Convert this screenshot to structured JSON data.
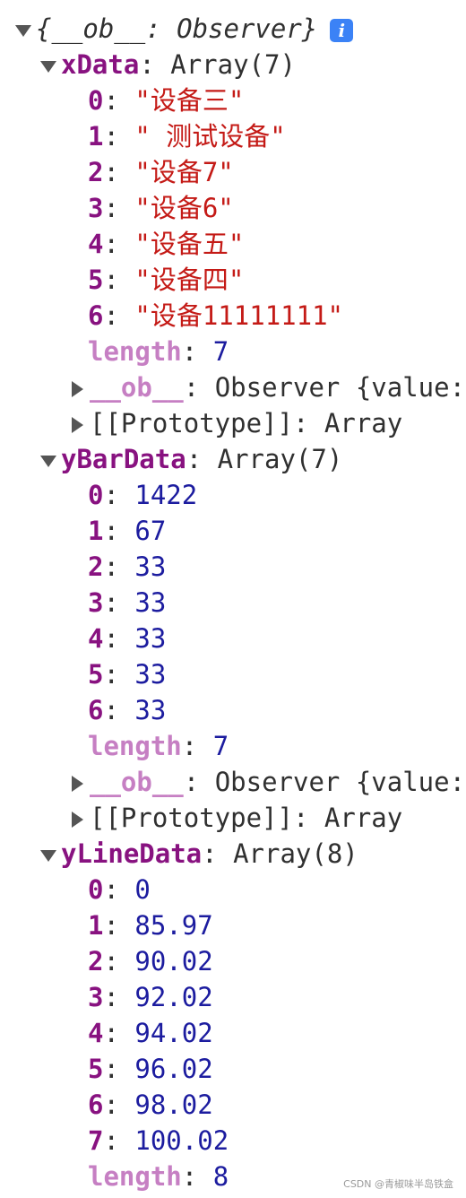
{
  "root": {
    "label": "{__ob__: Observer}",
    "info_icon": "i"
  },
  "xData": {
    "key": "xData",
    "summary": "Array(7)",
    "items": [
      {
        "index": "0",
        "value": "\"设备三\""
      },
      {
        "index": "1",
        "value": "\"  测试设备\""
      },
      {
        "index": "2",
        "value": "\"设备7\""
      },
      {
        "index": "3",
        "value": "\"设备6\""
      },
      {
        "index": "4",
        "value": "\"设备五\""
      },
      {
        "index": "5",
        "value": "\"设备四\""
      },
      {
        "index": "6",
        "value": "\"设备11111111\""
      }
    ],
    "length_key": "length",
    "length_value": "7",
    "ob_key": "__ob__",
    "ob_value": "Observer {value:",
    "proto_key": "[[Prototype]]",
    "proto_value": "Array"
  },
  "yBarData": {
    "key": "yBarData",
    "summary": "Array(7)",
    "items": [
      {
        "index": "0",
        "value": "1422"
      },
      {
        "index": "1",
        "value": "67"
      },
      {
        "index": "2",
        "value": "33"
      },
      {
        "index": "3",
        "value": "33"
      },
      {
        "index": "4",
        "value": "33"
      },
      {
        "index": "5",
        "value": "33"
      },
      {
        "index": "6",
        "value": "33"
      }
    ],
    "length_key": "length",
    "length_value": "7",
    "ob_key": "__ob__",
    "ob_value": "Observer {value:",
    "proto_key": "[[Prototype]]",
    "proto_value": "Array"
  },
  "yLineData": {
    "key": "yLineData",
    "summary": "Array(8)",
    "items": [
      {
        "index": "0",
        "value": "0"
      },
      {
        "index": "1",
        "value": "85.97"
      },
      {
        "index": "2",
        "value": "90.02"
      },
      {
        "index": "3",
        "value": "92.02"
      },
      {
        "index": "4",
        "value": "94.02"
      },
      {
        "index": "5",
        "value": "96.02"
      },
      {
        "index": "6",
        "value": "98.02"
      },
      {
        "index": "7",
        "value": "100.02"
      }
    ],
    "length_key": "length",
    "length_value": "8"
  },
  "watermark": "CSDN @青椒味半岛铁盒",
  "colors": {
    "key": "#881280",
    "key_dim": "#c67fc3",
    "string": "#c41a16",
    "number": "#1c1c9f",
    "info_badge": "#3b82f6"
  },
  "icons": {
    "expand": "triangle-down-icon",
    "collapse": "triangle-right-icon",
    "info": "info-icon"
  }
}
